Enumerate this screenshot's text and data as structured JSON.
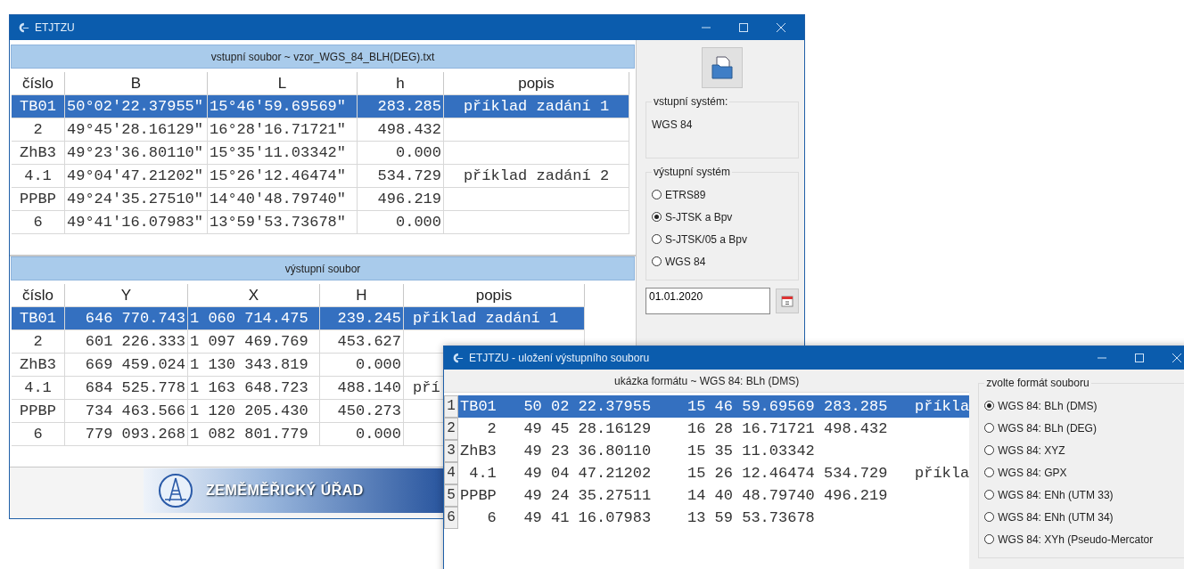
{
  "main_window": {
    "title": "ETJTZU",
    "input_file": {
      "header": "vstupní soubor ~ vzor_WGS_84_BLH(DEG).txt",
      "columns": [
        "číslo",
        "B",
        "L",
        "h",
        "popis"
      ],
      "rows": [
        {
          "cells": [
            "TB01",
            "50°02'22.37955\"",
            "15°46'59.69569\"",
            "283.285",
            "příklad zadání 1"
          ],
          "selected": true
        },
        {
          "cells": [
            "2",
            "49°45'28.16129\"",
            "16°28'16.71721\"",
            "498.432",
            ""
          ],
          "selected": false
        },
        {
          "cells": [
            "ZhB3",
            "49°23'36.80110\"",
            "15°35'11.03342\"",
            "0.000",
            ""
          ],
          "selected": false
        },
        {
          "cells": [
            "4.1",
            "49°04'47.21202\"",
            "15°26'12.46474\"",
            "534.729",
            "příklad zadání 2"
          ],
          "selected": false
        },
        {
          "cells": [
            "PPBP",
            "49°24'35.27510\"",
            "14°40'48.79740\"",
            "496.219",
            ""
          ],
          "selected": false
        },
        {
          "cells": [
            "6",
            "49°41'16.07983\"",
            "13°59'53.73678\"",
            "0.000",
            ""
          ],
          "selected": false
        }
      ]
    },
    "output_file": {
      "header": "výstupní soubor",
      "columns": [
        "číslo",
        "Y",
        "X",
        "H",
        "popis"
      ],
      "rows": [
        {
          "cells": [
            "TB01",
            "646 770.743",
            "1 060 714.475",
            "239.245",
            "příklad zadání 1"
          ],
          "selected": true
        },
        {
          "cells": [
            "2",
            "601 226.333",
            "1 097 469.769",
            "453.627",
            ""
          ],
          "selected": false
        },
        {
          "cells": [
            "ZhB3",
            "669 459.024",
            "1 130 343.819",
            "0.000",
            ""
          ],
          "selected": false
        },
        {
          "cells": [
            "4.1",
            "684 525.778",
            "1 163 648.723",
            "488.140",
            "pří"
          ],
          "selected": false
        },
        {
          "cells": [
            "PPBP",
            "734 463.566",
            "1 120 205.430",
            "450.273",
            ""
          ],
          "selected": false
        },
        {
          "cells": [
            "6",
            "779 093.268",
            "1 082 801.779",
            "0.000",
            ""
          ],
          "selected": false
        }
      ]
    },
    "input_system": {
      "label": "vstupní systém:",
      "value": "WGS 84"
    },
    "output_system": {
      "label": "výstupní systém",
      "options": [
        {
          "label": "ETRS89",
          "selected": false
        },
        {
          "label": "S-JTSK a Bpv",
          "selected": true
        },
        {
          "label": "S-JTSK/05 a Bpv",
          "selected": false
        },
        {
          "label": "WGS 84",
          "selected": false
        }
      ]
    },
    "date": {
      "value": "01.01.2020"
    },
    "banner": {
      "text": "ZEMĚMĚŘICKÝ ÚŘAD"
    }
  },
  "save_dialog": {
    "title": "ETJTZU - uložení výstupního souboru",
    "preview_header": "ukázka formátu ~ WGS 84: BLh (DMS)",
    "rows": [
      {
        "number": "1",
        "cells": [
          "TB01",
          "50 02 22.37955",
          "15 46 59.69569",
          "283.285",
          "příkla"
        ],
        "selected": true
      },
      {
        "number": "2",
        "cells": [
          "2",
          "49 45 28.16129",
          "16 28 16.71721",
          "498.432",
          ""
        ],
        "selected": false
      },
      {
        "number": "3",
        "cells": [
          "ZhB3",
          "49 23 36.80110",
          "15 35 11.03342",
          "",
          ""
        ],
        "selected": false
      },
      {
        "number": "4",
        "cells": [
          "4.1",
          "49 04 47.21202",
          "15 26 12.46474",
          "534.729",
          "příkla"
        ],
        "selected": false
      },
      {
        "number": "5",
        "cells": [
          "PPBP",
          "49 24 35.27511",
          "14 40 48.79740",
          "496.219",
          ""
        ],
        "selected": false
      },
      {
        "number": "6",
        "cells": [
          "6",
          "49 41 16.07983",
          "13 59 53.73678",
          "",
          ""
        ],
        "selected": false
      }
    ],
    "format": {
      "label": "zvolte formát souboru",
      "options": [
        {
          "label": "WGS 84: BLh (DMS)",
          "selected": true
        },
        {
          "label": "WGS 84: BLh (DEG)",
          "selected": false
        },
        {
          "label": "WGS 84: XYZ",
          "selected": false
        },
        {
          "label": "WGS 84: GPX",
          "selected": false
        },
        {
          "label": "WGS 84: ENh (UTM 33)",
          "selected": false
        },
        {
          "label": "WGS 84: ENh (UTM 34)",
          "selected": false
        },
        {
          "label": "WGS 84: XYh (Pseudo-Mercator",
          "selected": false
        }
      ]
    }
  }
}
